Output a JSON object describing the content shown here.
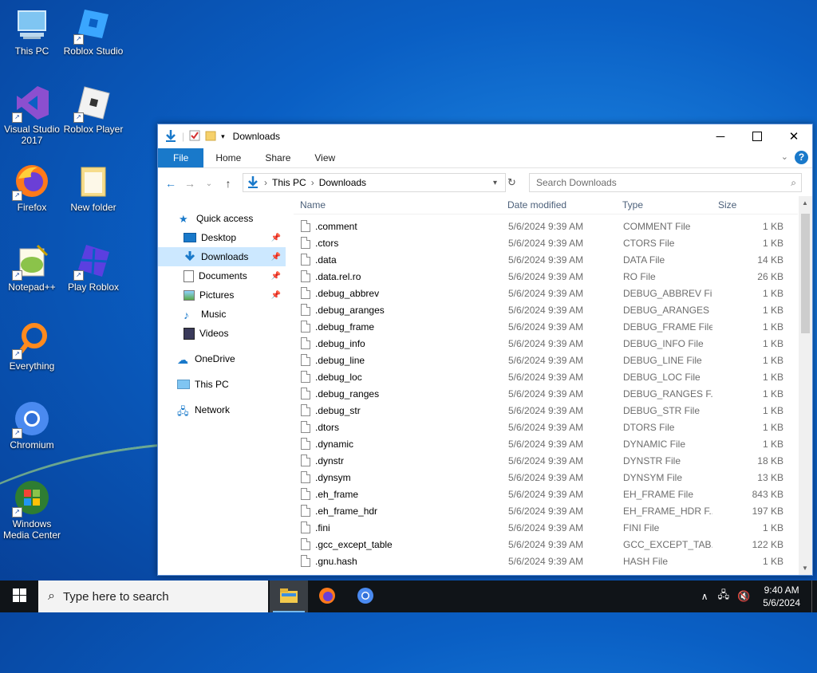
{
  "desktop": {
    "icons": [
      {
        "label": "This PC",
        "icon": "this-pc-icon"
      },
      {
        "label": "Roblox Studio",
        "icon": "roblox-studio-icon"
      },
      {
        "label": "Visual Studio 2017",
        "icon": "visual-studio-icon"
      },
      {
        "label": "Roblox Player",
        "icon": "roblox-player-icon"
      },
      {
        "label": "Firefox",
        "icon": "firefox-icon"
      },
      {
        "label": "New folder",
        "icon": "folder-icon"
      },
      {
        "label": "Notepad++",
        "icon": "notepadpp-icon"
      },
      {
        "label": "Play Roblox",
        "icon": "play-roblox-icon"
      },
      {
        "label": "Everything",
        "icon": "everything-icon"
      },
      {
        "label": "Chromium",
        "icon": "chromium-icon"
      },
      {
        "label": "Windows Media Center",
        "icon": "media-center-icon"
      }
    ]
  },
  "window": {
    "title": "Downloads",
    "tabs": {
      "file": "File",
      "home": "Home",
      "share": "Share",
      "view": "View"
    },
    "address": {
      "root": "This PC",
      "current": "Downloads"
    },
    "search_placeholder": "Search Downloads",
    "nav": {
      "quick_access": "Quick access",
      "desktop": "Desktop",
      "downloads": "Downloads",
      "documents": "Documents",
      "pictures": "Pictures",
      "music": "Music",
      "videos": "Videos",
      "onedrive": "OneDrive",
      "thispc": "This PC",
      "network": "Network"
    },
    "columns": {
      "name": "Name",
      "date": "Date modified",
      "type": "Type",
      "size": "Size"
    },
    "files": [
      {
        "name": ".comment",
        "date": "5/6/2024 9:39 AM",
        "type": "COMMENT File",
        "size": "1 KB"
      },
      {
        "name": ".ctors",
        "date": "5/6/2024 9:39 AM",
        "type": "CTORS File",
        "size": "1 KB"
      },
      {
        "name": ".data",
        "date": "5/6/2024 9:39 AM",
        "type": "DATA File",
        "size": "14 KB"
      },
      {
        "name": ".data.rel.ro",
        "date": "5/6/2024 9:39 AM",
        "type": "RO File",
        "size": "26 KB"
      },
      {
        "name": ".debug_abbrev",
        "date": "5/6/2024 9:39 AM",
        "type": "DEBUG_ABBREV File",
        "size": "1 KB"
      },
      {
        "name": ".debug_aranges",
        "date": "5/6/2024 9:39 AM",
        "type": "DEBUG_ARANGES ...",
        "size": "1 KB"
      },
      {
        "name": ".debug_frame",
        "date": "5/6/2024 9:39 AM",
        "type": "DEBUG_FRAME File",
        "size": "1 KB"
      },
      {
        "name": ".debug_info",
        "date": "5/6/2024 9:39 AM",
        "type": "DEBUG_INFO File",
        "size": "1 KB"
      },
      {
        "name": ".debug_line",
        "date": "5/6/2024 9:39 AM",
        "type": "DEBUG_LINE File",
        "size": "1 KB"
      },
      {
        "name": ".debug_loc",
        "date": "5/6/2024 9:39 AM",
        "type": "DEBUG_LOC File",
        "size": "1 KB"
      },
      {
        "name": ".debug_ranges",
        "date": "5/6/2024 9:39 AM",
        "type": "DEBUG_RANGES F...",
        "size": "1 KB"
      },
      {
        "name": ".debug_str",
        "date": "5/6/2024 9:39 AM",
        "type": "DEBUG_STR File",
        "size": "1 KB"
      },
      {
        "name": ".dtors",
        "date": "5/6/2024 9:39 AM",
        "type": "DTORS File",
        "size": "1 KB"
      },
      {
        "name": ".dynamic",
        "date": "5/6/2024 9:39 AM",
        "type": "DYNAMIC File",
        "size": "1 KB"
      },
      {
        "name": ".dynstr",
        "date": "5/6/2024 9:39 AM",
        "type": "DYNSTR File",
        "size": "18 KB"
      },
      {
        "name": ".dynsym",
        "date": "5/6/2024 9:39 AM",
        "type": "DYNSYM File",
        "size": "13 KB"
      },
      {
        "name": ".eh_frame",
        "date": "5/6/2024 9:39 AM",
        "type": "EH_FRAME File",
        "size": "843 KB"
      },
      {
        "name": ".eh_frame_hdr",
        "date": "5/6/2024 9:39 AM",
        "type": "EH_FRAME_HDR F...",
        "size": "197 KB"
      },
      {
        "name": ".fini",
        "date": "5/6/2024 9:39 AM",
        "type": "FINI File",
        "size": "1 KB"
      },
      {
        "name": ".gcc_except_table",
        "date": "5/6/2024 9:39 AM",
        "type": "GCC_EXCEPT_TAB...",
        "size": "122 KB"
      },
      {
        "name": ".gnu.hash",
        "date": "5/6/2024 9:39 AM",
        "type": "HASH File",
        "size": "1 KB"
      }
    ]
  },
  "taskbar": {
    "search_placeholder": "Type here to search",
    "time": "9:40 AM",
    "date": "5/6/2024"
  },
  "colors": {
    "accent": "#1979ca",
    "selection": "#cce8ff",
    "taskbar": "#101418"
  }
}
